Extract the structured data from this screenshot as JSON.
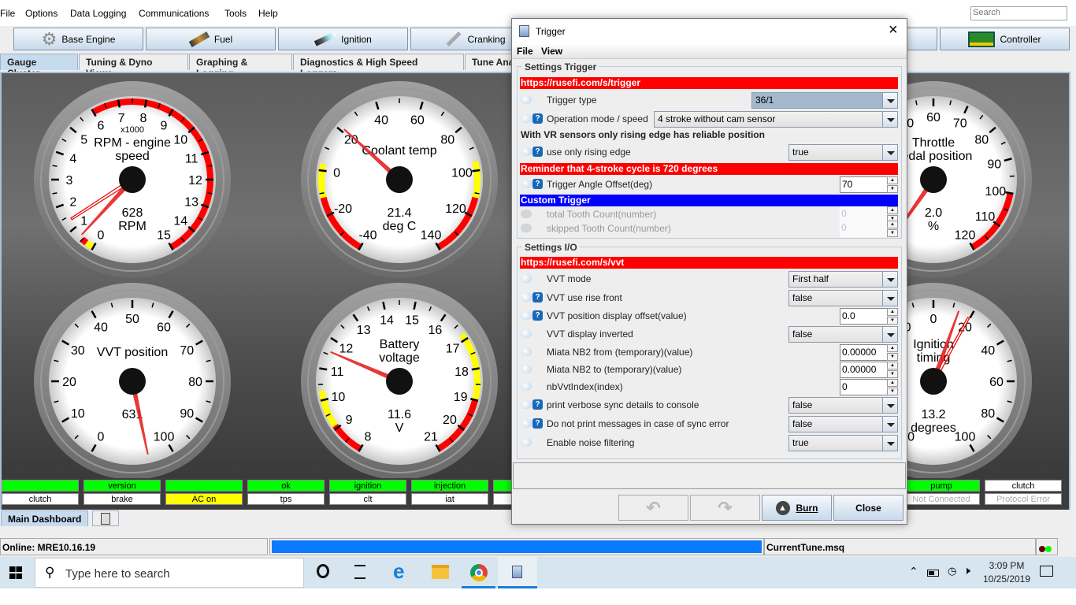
{
  "menu": [
    "File",
    "Options",
    "Data Logging",
    "Communications",
    "Tools",
    "Help"
  ],
  "search_placeholder": "Search",
  "toolbar": [
    {
      "label": "Base Engine",
      "icon": "gear-icon"
    },
    {
      "label": "Fuel",
      "icon": "injector-icon"
    },
    {
      "label": "Ignition",
      "icon": "spark-plug-icon"
    },
    {
      "label": "Cranking",
      "icon": "wrench-icon"
    },
    {
      "label": "Controller",
      "icon": "circuit-board-icon"
    }
  ],
  "tabs": [
    "Gauge Cluster",
    "Tuning & Dyno Views",
    "Graphing & Logging",
    "Diagnostics & High Speed Loggers",
    "Tune Analyzer"
  ],
  "gauges": [
    {
      "title": [
        "RPM - engine",
        "speed"
      ],
      "multiplier": "x1000",
      "value_text": "628",
      "units": "RPM",
      "min": 0,
      "max": 15,
      "value": 0.628,
      "peak": 1.36,
      "major": 1,
      "minor": 0.5,
      "ranges": [
        {
          "from": 0,
          "to": 0.3,
          "color": "#ffff00"
        },
        {
          "from": 0.3,
          "to": 0.5,
          "color": "#ff0000"
        },
        {
          "from": 6,
          "to": 15,
          "color": "#ff0000"
        }
      ]
    },
    {
      "title": [
        "Coolant temp"
      ],
      "value_text": "21.4",
      "units": "deg C",
      "min": -40,
      "max": 140,
      "value": 21.4,
      "major": 20,
      "minor": 10,
      "ranges": [
        {
          "from": -40,
          "to": -12,
          "color": "#ff0000"
        },
        {
          "from": -12,
          "to": 3,
          "color": "#ffff00"
        },
        {
          "from": 96,
          "to": 112,
          "color": "#ffff00"
        },
        {
          "from": 112,
          "to": 140,
          "color": "#ff0000"
        }
      ]
    },
    {
      "title": [
        "VVT position"
      ],
      "value_text": "631",
      "units": "",
      "min": 0,
      "max": 100,
      "value": 631,
      "major": 10,
      "minor": 5,
      "ranges": []
    },
    {
      "title": [
        "Battery",
        "voltage"
      ],
      "value_text": "11.6",
      "units": "V",
      "min": 8,
      "max": 21,
      "value": 11.6,
      "major": 1,
      "minor": 0.5,
      "ranges": [
        {
          "from": 8,
          "to": 9.1,
          "color": "#ff0000"
        },
        {
          "from": 9.1,
          "to": 10.3,
          "color": "#ffff00"
        },
        {
          "from": 16.8,
          "to": 19,
          "color": "#ffff00"
        },
        {
          "from": 19,
          "to": 21,
          "color": "#ff0000"
        }
      ]
    },
    {
      "title": [
        "Throttle",
        "pedal position"
      ],
      "value_text": "2.0",
      "units": "%",
      "min": 0,
      "max": 120,
      "value": 2.0,
      "major": 10,
      "minor": 5,
      "ranges": [
        {
          "from": 100,
          "to": 120,
          "color": "#ff0000"
        }
      ]
    },
    {
      "title": [
        "Ignition",
        "timing"
      ],
      "value_text": "13.2",
      "units": "degrees",
      "min": -100,
      "max": 100,
      "value": 13.2,
      "peak": 19.3,
      "major": 20,
      "minor": 10,
      "ranges": []
    }
  ],
  "indicators_top": [
    {
      "label": "",
      "bg": "#00ff00"
    },
    {
      "label": "version",
      "bg": "#00ff00"
    },
    {
      "label": "",
      "bg": "#00ff00"
    },
    {
      "label": "ok",
      "bg": "#00ff00"
    },
    {
      "label": "ignition",
      "bg": "#00ff00"
    },
    {
      "label": "injection",
      "bg": "#00ff00"
    },
    {
      "label": "",
      "bg": "#00ff00"
    },
    {
      "label": "pump",
      "bg": "#00ff00"
    },
    {
      "label": "clutch",
      "bg": "#ffffff"
    }
  ],
  "indicators_bottom": [
    {
      "label": "clutch",
      "bg": "#ffffff"
    },
    {
      "label": "brake",
      "bg": "#ffffff"
    },
    {
      "label": "AC on",
      "bg": "#ffff00"
    },
    {
      "label": "tps",
      "bg": "#ffffff"
    },
    {
      "label": "clt",
      "bg": "#ffffff"
    },
    {
      "label": "iat",
      "bg": "#ffffff"
    },
    {
      "label": "",
      "bg": "#ffffff"
    },
    {
      "label": "Not Connected",
      "bg": "#ffffff",
      "dim": true
    },
    {
      "label": "Protocol Error",
      "bg": "#ffffff",
      "dim": true
    }
  ],
  "dashboard_tab": "Main Dashboard",
  "status": {
    "online": "Online: MRE10.16.19",
    "progress": 100,
    "tune_file": "CurrentTune.msq"
  },
  "dialog": {
    "title": "Trigger",
    "menu": [
      "File",
      "View"
    ],
    "sections": [
      {
        "legend": "Settings Trigger",
        "items": [
          {
            "type": "bar",
            "text": "https://rusefi.com/s/trigger",
            "color": "#ff0000"
          },
          {
            "type": "combo",
            "label": "Trigger type",
            "value": "36/1",
            "help": false,
            "selected": true
          },
          {
            "type": "combo",
            "label": "Operation mode / speed",
            "value": "4 stroke without cam sensor",
            "help": true,
            "wide": true
          },
          {
            "type": "text",
            "text": "With VR sensors only rising edge has reliable position"
          },
          {
            "type": "combo",
            "label": "use only rising edge",
            "value": "true",
            "help": true
          },
          {
            "type": "bar",
            "text": "Reminder that 4-stroke cycle is 720 degrees",
            "color": "#ff0000"
          },
          {
            "type": "spin",
            "label": "Trigger Angle Offset(deg)",
            "value": "70",
            "help": true
          },
          {
            "type": "bar",
            "text": "Custom Trigger",
            "color": "#0000ff"
          },
          {
            "type": "spin",
            "label": "total Tooth Count(number)",
            "value": "0",
            "disabled": true
          },
          {
            "type": "spin",
            "label": "skipped Tooth Count(number)",
            "value": "0",
            "disabled": true
          }
        ]
      },
      {
        "legend": "Settings I/O",
        "items": [
          {
            "type": "bar",
            "text": "https://rusefi.com/s/vvt",
            "color": "#ff0000"
          },
          {
            "type": "combo",
            "label": "VVT mode",
            "value": "First half"
          },
          {
            "type": "combo",
            "label": "VVT use rise front",
            "value": "false",
            "help": true
          },
          {
            "type": "spin",
            "label": "VVT position display offset(value)",
            "value": "0.0",
            "help": true
          },
          {
            "type": "combo",
            "label": "VVT display inverted",
            "value": "false"
          },
          {
            "type": "spin",
            "label": "Miata NB2 from (temporary)(value)",
            "value": "0.00000"
          },
          {
            "type": "spin",
            "label": "Miata NB2 to (temporary)(value)",
            "value": "0.00000"
          },
          {
            "type": "spin",
            "label": "nbVvtIndex(index)",
            "value": "0"
          },
          {
            "type": "combo",
            "label": "print verbose sync details to console",
            "value": "false",
            "help": true
          },
          {
            "type": "combo",
            "label": "Do not print messages in case of sync error",
            "value": "false",
            "help": true
          },
          {
            "type": "combo",
            "label": "Enable noise filtering",
            "value": "true"
          }
        ]
      }
    ],
    "burn": "Burn",
    "close": "Close"
  },
  "taskbar": {
    "search_placeholder": "Type here to search",
    "time": "3:09 PM",
    "date": "10/25/2019"
  }
}
